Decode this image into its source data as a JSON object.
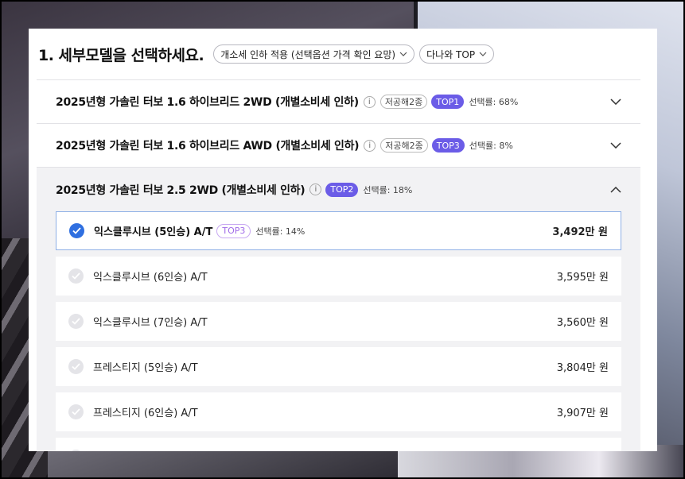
{
  "header": {
    "title": "1. 세부모델을 선택하세요.",
    "filter_label": "개소세 인하 적용 (선택옵션 가격 확인 요망)",
    "sort_label": "다나와 TOP"
  },
  "models": [
    {
      "title": "2025년형 가솔린 터보 1.6 하이브리드 2WD (개별소비세 인하)",
      "info": "i",
      "tag": "저공해2종",
      "top": "TOP1",
      "rate": "선택률: 68%"
    },
    {
      "title": "2025년형 가솔린 터보 1.6 하이브리드 AWD (개별소비세 인하)",
      "info": "i",
      "tag": "저공해2종",
      "top": "TOP3",
      "rate": "선택률: 8%"
    },
    {
      "title": "2025년형 가솔린 터보 2.5 2WD (개별소비세 인하)",
      "info": "i",
      "top": "TOP2",
      "rate": "선택률: 18%"
    }
  ],
  "options": [
    {
      "name": "익스클루시브 (5인승) A/T",
      "top": "TOP3",
      "rate": "선택률: 14%",
      "price": "3,492만 원",
      "selected": true
    },
    {
      "name": "익스클루시브 (6인승) A/T",
      "price": "3,595만 원",
      "selected": false
    },
    {
      "name": "익스클루시브 (7인승) A/T",
      "price": "3,560만 원",
      "selected": false
    },
    {
      "name": "프레스티지 (5인승) A/T",
      "price": "3,804만 원",
      "selected": false
    },
    {
      "name": "프레스티지 (6인승) A/T",
      "price": "3,907만 원",
      "selected": false
    }
  ],
  "colors": {
    "accent": "#6b5ce7",
    "check": "#2f6fe0"
  }
}
